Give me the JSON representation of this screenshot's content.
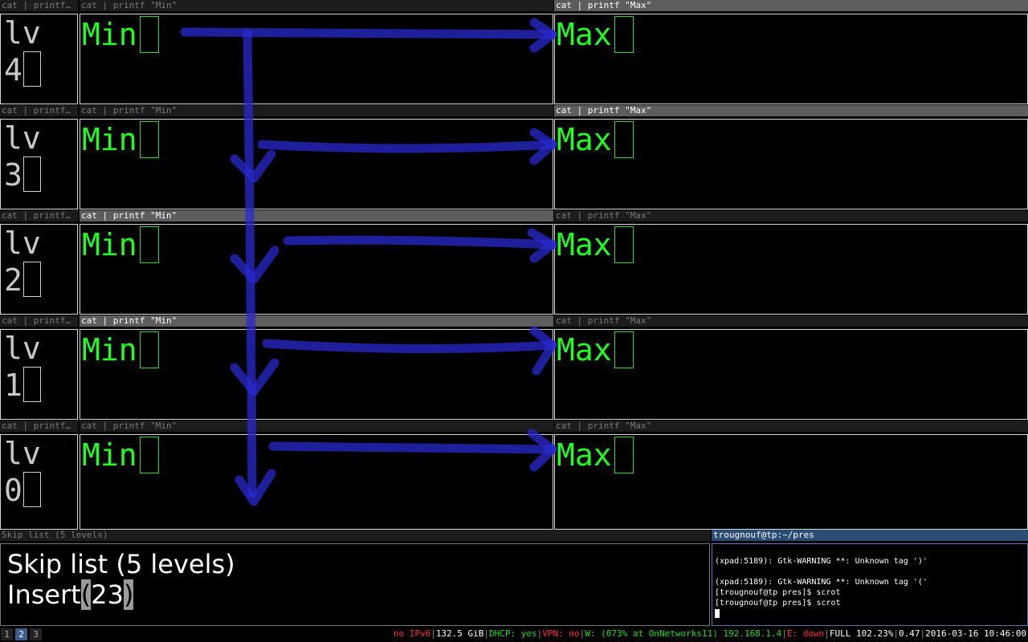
{
  "level_titles": [
    "cat | printf…",
    "cat | printf…",
    "cat | printf…",
    "cat | printf…",
    "cat | printf…"
  ],
  "level_labels": [
    "lv",
    "lv",
    "lv",
    "lv",
    "lv"
  ],
  "level_numbers": [
    "4",
    "3",
    "2",
    "1",
    "0"
  ],
  "min_title": "cat | printf \"Min\"",
  "max_title": "cat | printf \"Max\"",
  "min_text": "Min",
  "max_text": "Max",
  "main": {
    "title": "Skip list (5 levels)",
    "line1": "Skip list (5 levels)",
    "insert_word": "Insert",
    "paren_open": "(",
    "value": "23",
    "paren_close": ")"
  },
  "terminal": {
    "title": "trougnouf@tp:~/pres",
    "lines": [
      "",
      "(xpad:5189): Gtk-WARNING **: Unknown tag ')'",
      "",
      "(xpad:5189): Gtk-WARNING **: Unknown tag '('",
      "[trougnouf@tp pres]$ scrot",
      "[trougnouf@tp pres]$ scrot"
    ]
  },
  "workspaces": [
    "1",
    "2",
    "3"
  ],
  "status": {
    "ipv6": "no IPv6",
    "disk": "132.5 GiB",
    "dhcp": "DHCP: yes",
    "vpn": "VPN: no",
    "wifi": "W: (073% at OnNetworks11) 192.168.1.4",
    "eth": "E: down",
    "battery": "FULL 102.23%",
    "load": "0.47",
    "datetime": "2016-03-16 10:46:00"
  },
  "colors": {
    "green_text": "#22ff22",
    "overlay_blue": "#2a2ad0",
    "active_ws": "#3b5f8a"
  }
}
